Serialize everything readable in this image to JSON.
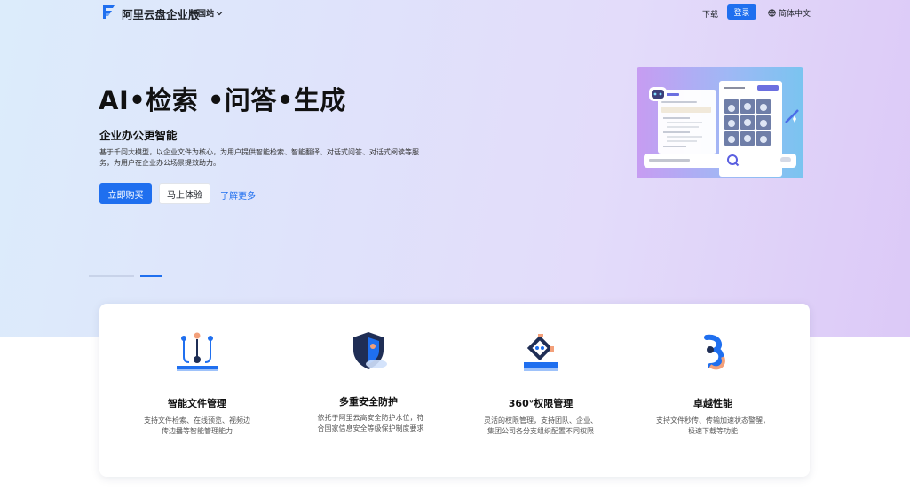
{
  "header": {
    "brand": "阿里云盘企业版",
    "region": "中国站",
    "download": "下载",
    "login": "登录",
    "language": "简体中文",
    "icons": [
      "logo-f-icon",
      "chevron-down-icon",
      "globe-icon"
    ]
  },
  "hero": {
    "title": "AI•检索 •问答•生成",
    "subtitle": "企业办公更智能",
    "description": "基于千问大模型，以企业文件为核心，为用户提供智能检索、智能翻译、对话式问答、对话式阅读等服务，为用户在企业办公场景提效助力。",
    "buy_label": "立即购买",
    "try_label": "马上体验",
    "learn_more": "了解更多",
    "active_slide": 2,
    "slide_count": 2
  },
  "mockup": {
    "bot_name": "AI助手",
    "greeting": "Hi~我是您的AI助手",
    "search_placeholder": "输入“@”来提 提问文件, Enter键发送",
    "ocr_label": "实景图片相似检索"
  },
  "colors": {
    "accent": "#1f6fef",
    "hero_left": "#dcecfb",
    "hero_right": "#dcc9f7"
  },
  "features": [
    {
      "title": "智能文件管理",
      "desc": "支持文件检索、在线预览、视频边传边播等智能管理能力",
      "icon": "file-management-icon"
    },
    {
      "title": "多重安全防护",
      "desc": "依托于阿里云高安全防护水位，符合国家信息安全等级保护制度要求",
      "icon": "shield-icon"
    },
    {
      "title": "360°权限管理",
      "desc": "灵活的权限管理，支持团队、企业、集团公司各分支组织配置不同权限",
      "icon": "permission-icon"
    },
    {
      "title": "卓越性能",
      "desc": "支持文件秒传、传输加速状态警醒，极速下载等功能",
      "icon": "performance-icon"
    }
  ]
}
